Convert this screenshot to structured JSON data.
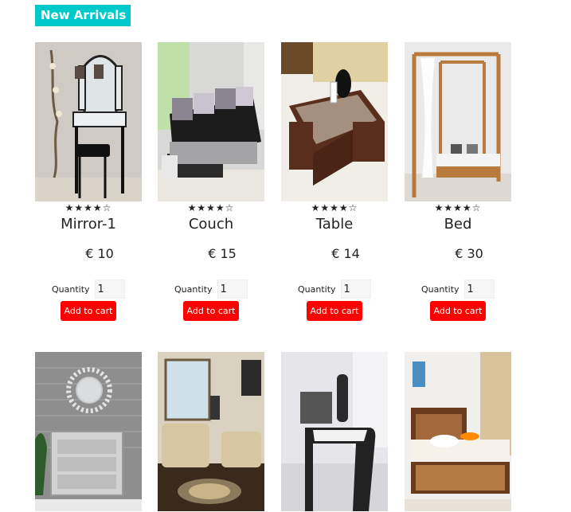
{
  "section": {
    "title": "New Arrivals",
    "accent": "#00c9c9"
  },
  "products": [
    {
      "name": "Mirror-1",
      "price": "€ 10",
      "rating": "★★★★☆",
      "quantity_label": "Quantity",
      "quantity": "1",
      "button": "Add to cart"
    },
    {
      "name": "Couch",
      "price": "€ 15",
      "rating": "★★★★☆",
      "quantity_label": "Quantity",
      "quantity": "1",
      "button": "Add to cart"
    },
    {
      "name": "Table",
      "price": "€ 14",
      "rating": "★★★★☆",
      "quantity_label": "Quantity",
      "quantity": "1",
      "button": "Add to cart"
    },
    {
      "name": "Bed",
      "price": "€ 30",
      "rating": "★★★★☆",
      "quantity_label": "Quantity",
      "quantity": "1",
      "button": "Add to cart"
    }
  ],
  "more_products": [
    {
      "image": "mirror-cabinet"
    },
    {
      "image": "sofa-set"
    },
    {
      "image": "office-desk"
    },
    {
      "image": "storage-bed"
    }
  ],
  "colors": {
    "button": "#ff0000",
    "badge": "#00c9c9"
  }
}
